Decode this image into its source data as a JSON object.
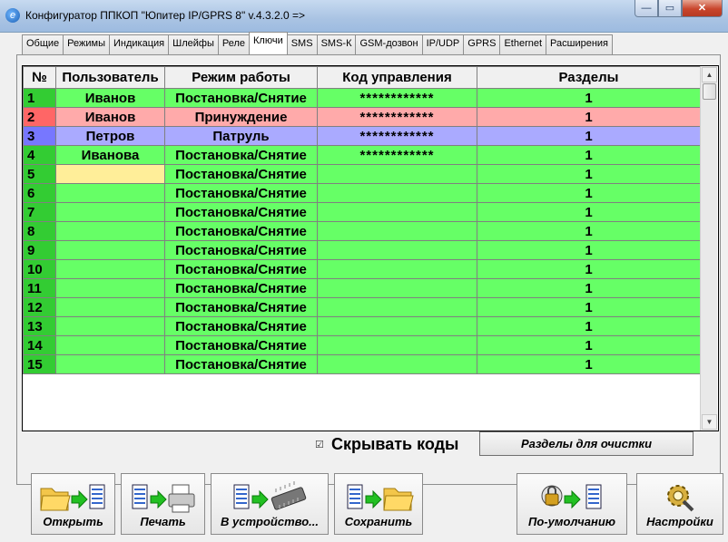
{
  "window": {
    "title": "Конфигуратор ППКОП \"Юпитер IP/GPRS 8\" v.4.3.2.0  =>",
    "min_glyph": "—",
    "max_glyph": "▭",
    "close_glyph": "✕"
  },
  "tabs": [
    {
      "label": "Общие"
    },
    {
      "label": "Режимы"
    },
    {
      "label": "Индикация"
    },
    {
      "label": "Шлейфы"
    },
    {
      "label": "Реле"
    },
    {
      "label": "Ключи",
      "active": true
    },
    {
      "label": "SMS"
    },
    {
      "label": "SMS-К"
    },
    {
      "label": "GSM-дозвон"
    },
    {
      "label": "IP/UDP"
    },
    {
      "label": "GPRS"
    },
    {
      "label": "Ethernet"
    },
    {
      "label": "Расширения"
    }
  ],
  "grid": {
    "headers": {
      "num": "№",
      "user": "Пользователь",
      "mode": "Режим работы",
      "code": "Код управления",
      "sections": "Разделы"
    },
    "rows": [
      {
        "num": "1",
        "user": "Иванов",
        "mode": "Постановка/Снятие",
        "code": "************",
        "sections": "1",
        "color": "green"
      },
      {
        "num": "2",
        "user": "Иванов",
        "mode": "Принуждение",
        "code": "************",
        "sections": "1",
        "color": "pink"
      },
      {
        "num": "3",
        "user": "Петров",
        "mode": "Патруль",
        "code": "************",
        "sections": "1",
        "color": "blue"
      },
      {
        "num": "4",
        "user": "Иванова",
        "mode": "Постановка/Снятие",
        "code": "************",
        "sections": "1",
        "color": "green"
      },
      {
        "num": "5",
        "user": "",
        "mode": "Постановка/Снятие",
        "code": "",
        "sections": "1",
        "color": "green",
        "editing": true
      },
      {
        "num": "6",
        "user": "",
        "mode": "Постановка/Снятие",
        "code": "",
        "sections": "1",
        "color": "green"
      },
      {
        "num": "7",
        "user": "",
        "mode": "Постановка/Снятие",
        "code": "",
        "sections": "1",
        "color": "green"
      },
      {
        "num": "8",
        "user": "",
        "mode": "Постановка/Снятие",
        "code": "",
        "sections": "1",
        "color": "green"
      },
      {
        "num": "9",
        "user": "",
        "mode": "Постановка/Снятие",
        "code": "",
        "sections": "1",
        "color": "green"
      },
      {
        "num": "10",
        "user": "",
        "mode": "Постановка/Снятие",
        "code": "",
        "sections": "1",
        "color": "green"
      },
      {
        "num": "11",
        "user": "",
        "mode": "Постановка/Снятие",
        "code": "",
        "sections": "1",
        "color": "green"
      },
      {
        "num": "12",
        "user": "",
        "mode": "Постановка/Снятие",
        "code": "",
        "sections": "1",
        "color": "green"
      },
      {
        "num": "13",
        "user": "",
        "mode": "Постановка/Снятие",
        "code": "",
        "sections": "1",
        "color": "green"
      },
      {
        "num": "14",
        "user": "",
        "mode": "Постановка/Снятие",
        "code": "",
        "sections": "1",
        "color": "green"
      },
      {
        "num": "15",
        "user": "",
        "mode": "Постановка/Снятие",
        "code": "",
        "sections": "1",
        "color": "green"
      }
    ]
  },
  "options": {
    "hide_codes_check": "☑",
    "hide_codes_label": "Скрывать коды",
    "clear_sections_label": "Разделы для очистки"
  },
  "toolbar": {
    "open_label": "Открыть",
    "print_label": "Печать",
    "to_device_label": "В устройство...",
    "save_label": "Сохранить",
    "defaults_label": "По-умолчанию",
    "settings_label": "Настройки"
  },
  "colors": {
    "green_row": "#66ff66",
    "pink_row": "#ffaaaa",
    "blue_row": "#aaaaff",
    "edit_cell": "#ffee99"
  }
}
